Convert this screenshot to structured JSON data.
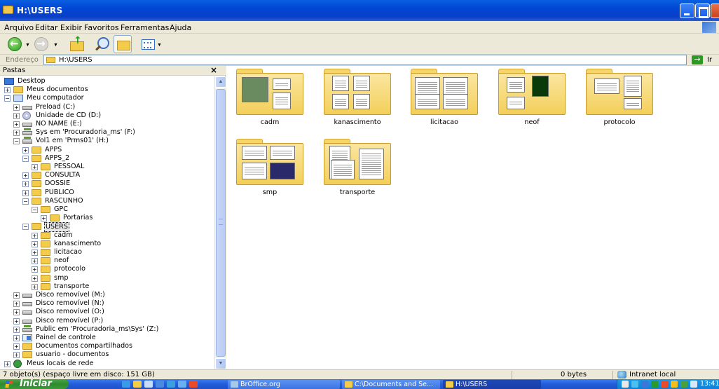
{
  "window": {
    "title": "H:\\USERS"
  },
  "menu": {
    "items": [
      "Arquivo",
      "Editar",
      "Exibir",
      "Favoritos",
      "Ferramentas",
      "Ajuda"
    ]
  },
  "toolbar": {
    "icons": [
      "back-icon",
      "forward-icon",
      "up-folder-icon",
      "search-icon",
      "folders-icon",
      "views-icon"
    ]
  },
  "address": {
    "label": "Endereço",
    "value": "H:\\USERS",
    "go_label": "Ir"
  },
  "folder_pane": {
    "header": "Pastas",
    "close": "×",
    "tree": [
      {
        "label": "Desktop",
        "icon": "desktop-icon",
        "level": 0,
        "expander": ""
      },
      {
        "label": "Meus documentos",
        "icon": "folder-icon",
        "level": 1,
        "expander": "+"
      },
      {
        "label": "Meu computador",
        "icon": "computer-icon",
        "level": 1,
        "expander": "−"
      },
      {
        "label": "Preload (C:)",
        "icon": "drive-icon",
        "level": 2,
        "expander": "+"
      },
      {
        "label": "Unidade de CD (D:)",
        "icon": "cd-drive-icon",
        "level": 2,
        "expander": "+"
      },
      {
        "label": "NO NAME (E:)",
        "icon": "drive-icon",
        "level": 2,
        "expander": "+"
      },
      {
        "label": "Sys em 'Procuradoria_ms' (F:)",
        "icon": "network-drive-icon",
        "level": 2,
        "expander": "+"
      },
      {
        "label": "Vol1 em 'Prms01' (H:)",
        "icon": "network-drive-icon",
        "level": 2,
        "expander": "−"
      },
      {
        "label": "APPS",
        "icon": "folder-icon",
        "level": 3,
        "expander": "+"
      },
      {
        "label": "APPS_2",
        "icon": "folder-icon",
        "level": 3,
        "expander": "−"
      },
      {
        "label": "PESSOAL",
        "icon": "folder-icon",
        "level": 4,
        "expander": "+"
      },
      {
        "label": "CONSULTA",
        "icon": "folder-icon",
        "level": 3,
        "expander": "+"
      },
      {
        "label": "DOSSIE",
        "icon": "folder-icon",
        "level": 3,
        "expander": "+"
      },
      {
        "label": "PUBLICO",
        "icon": "folder-icon",
        "level": 3,
        "expander": "+"
      },
      {
        "label": "RASCUNHO",
        "icon": "folder-icon",
        "level": 3,
        "expander": "−"
      },
      {
        "label": "GPC",
        "icon": "folder-icon",
        "level": 4,
        "expander": "−"
      },
      {
        "label": "Portarias",
        "icon": "folder-icon",
        "level": 5,
        "expander": "+"
      },
      {
        "label": "USERS",
        "icon": "folder-open-icon",
        "level": 3,
        "expander": "−",
        "selected": true
      },
      {
        "label": "cadm",
        "icon": "folder-icon",
        "level": 4,
        "expander": "+"
      },
      {
        "label": "kanascimento",
        "icon": "folder-icon",
        "level": 4,
        "expander": "+"
      },
      {
        "label": "licitacao",
        "icon": "folder-icon",
        "level": 4,
        "expander": "+"
      },
      {
        "label": "neof",
        "icon": "folder-icon",
        "level": 4,
        "expander": "+"
      },
      {
        "label": "protocolo",
        "icon": "folder-icon",
        "level": 4,
        "expander": "+"
      },
      {
        "label": "smp",
        "icon": "folder-icon",
        "level": 4,
        "expander": "+"
      },
      {
        "label": "transporte",
        "icon": "folder-icon",
        "level": 4,
        "expander": "+"
      },
      {
        "label": "Disco removível (M:)",
        "icon": "drive-icon",
        "level": 2,
        "expander": "+"
      },
      {
        "label": "Disco removível (N:)",
        "icon": "drive-icon",
        "level": 2,
        "expander": "+"
      },
      {
        "label": "Disco removível (O:)",
        "icon": "drive-icon",
        "level": 2,
        "expander": "+"
      },
      {
        "label": "Disco removível (P:)",
        "icon": "drive-icon",
        "level": 2,
        "expander": "+"
      },
      {
        "label": "Public em 'Procuradoria_ms\\Sys' (Z:)",
        "icon": "network-drive-icon",
        "level": 2,
        "expander": "+"
      },
      {
        "label": "Painel de controle",
        "icon": "control-panel-icon",
        "level": 2,
        "expander": "+"
      },
      {
        "label": "Documentos compartilhados",
        "icon": "folder-icon",
        "level": 2,
        "expander": "+"
      },
      {
        "label": "usuario - documentos",
        "icon": "folder-icon",
        "level": 2,
        "expander": "+"
      },
      {
        "label": "Meus locais de rede",
        "icon": "network-places-icon",
        "level": 1,
        "expander": "+"
      }
    ]
  },
  "content": {
    "folders": [
      "cadm",
      "kanascimento",
      "licitacao",
      "neof",
      "protocolo",
      "smp",
      "transporte"
    ]
  },
  "status": {
    "objects": "7 objeto(s) (espaço livre em disco: 151 GB)",
    "size": "0 bytes",
    "zone": "Intranet local"
  },
  "taskbar": {
    "start": "Iniciar",
    "tasks": [
      {
        "label": "BrOffice.org",
        "active": false
      },
      {
        "label": "C:\\Documents and Se...",
        "active": false
      },
      {
        "label": "H:\\USERS",
        "active": true
      }
    ],
    "clock": "13:41"
  }
}
